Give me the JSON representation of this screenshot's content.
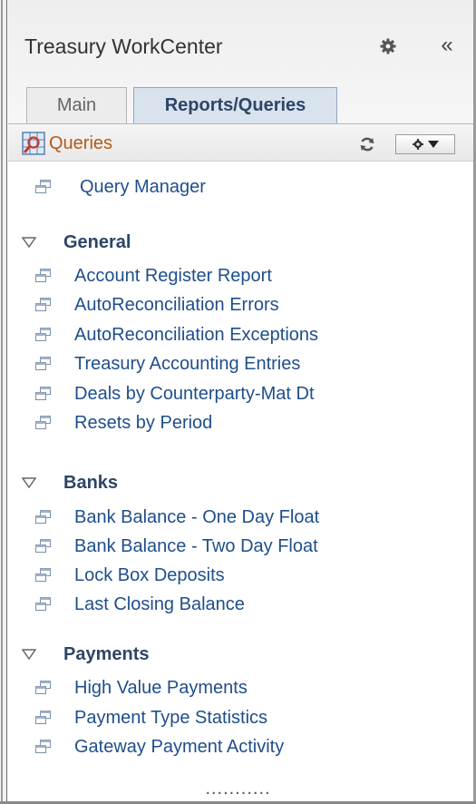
{
  "header": {
    "title": "Treasury WorkCenter",
    "settings_icon": "gear-icon",
    "collapse_label": "«"
  },
  "tabs": [
    {
      "label": "Main",
      "active": false
    },
    {
      "label": "Reports/Queries",
      "active": true
    }
  ],
  "section": {
    "title": "Queries",
    "icon": "queries-icon",
    "refresh_icon": "refresh-icon",
    "options_icon": "gear-dropdown-icon"
  },
  "query_manager": {
    "label": "Query Manager"
  },
  "groups": [
    {
      "name": "General",
      "items": [
        {
          "label": "Account Register Report"
        },
        {
          "label": "AutoReconciliation Errors"
        },
        {
          "label": "AutoReconciliation Exceptions"
        },
        {
          "label": "Treasury Accounting Entries"
        },
        {
          "label": "Deals by Counterparty-Mat Dt"
        },
        {
          "label": "Resets by Period"
        }
      ]
    },
    {
      "name": "Banks",
      "items": [
        {
          "label": "Bank Balance - One Day Float"
        },
        {
          "label": "Bank Balance - Two Day Float"
        },
        {
          "label": "Lock Box Deposits"
        },
        {
          "label": "Last Closing Balance"
        }
      ]
    },
    {
      "name": "Payments",
      "items": [
        {
          "label": "High Value Payments"
        },
        {
          "label": "Payment Type Statistics"
        },
        {
          "label": "Gateway Payment Activity"
        }
      ]
    }
  ],
  "footer": {
    "more_label": "..........."
  },
  "colors": {
    "link": "#1f4e8c",
    "group_heading": "#2d4566",
    "section_title": "#b35a18",
    "active_tab_bg": "#d9e3ee"
  }
}
